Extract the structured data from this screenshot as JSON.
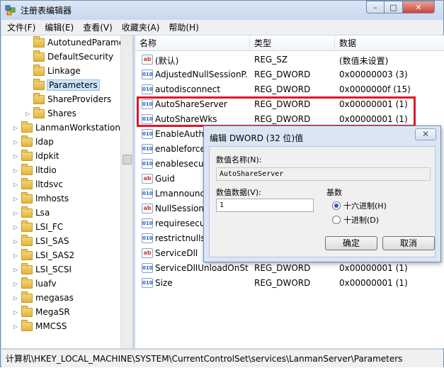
{
  "window": {
    "title": "注册表编辑器",
    "min_label": "–",
    "max_label": "□",
    "close_label": "✕"
  },
  "menu": [
    "文件(F)",
    "编辑(E)",
    "查看(V)",
    "收藏夹(A)",
    "帮助(H)"
  ],
  "tree": {
    "items": [
      {
        "label": "AutotunedParame",
        "expand": ""
      },
      {
        "label": "DefaultSecurity",
        "expand": ""
      },
      {
        "label": "Linkage",
        "expand": ""
      },
      {
        "label": "Parameters",
        "expand": "",
        "selected": true
      },
      {
        "label": "ShareProviders",
        "expand": ""
      },
      {
        "label": "Shares",
        "expand": "▷"
      },
      {
        "label": "LanmanWorkstation",
        "expand": "▷"
      },
      {
        "label": "ldap",
        "expand": "▷"
      },
      {
        "label": "ldpkit",
        "expand": "▷"
      },
      {
        "label": "lltdio",
        "expand": "▷"
      },
      {
        "label": "lltdsvc",
        "expand": "▷"
      },
      {
        "label": "lmhosts",
        "expand": "▷"
      },
      {
        "label": "Lsa",
        "expand": "▷"
      },
      {
        "label": "LSI_FC",
        "expand": "▷"
      },
      {
        "label": "LSI_SAS",
        "expand": "▷"
      },
      {
        "label": "LSI_SAS2",
        "expand": "▷"
      },
      {
        "label": "LSI_SCSI",
        "expand": "▷"
      },
      {
        "label": "luafv",
        "expand": "▷"
      },
      {
        "label": "megasas",
        "expand": "▷"
      },
      {
        "label": "MegaSR",
        "expand": "▷"
      },
      {
        "label": "MMCSS",
        "expand": "▷"
      }
    ]
  },
  "list": {
    "headers": {
      "name": "名称",
      "type": "类型",
      "data": "数据"
    },
    "rows": [
      {
        "icon": "ab",
        "name": "(默认)",
        "type": "REG_SZ",
        "data": "(数值未设置)"
      },
      {
        "icon": "dw",
        "name": "AdjustedNullSessionP...",
        "type": "REG_DWORD",
        "data": "0x00000003 (3)"
      },
      {
        "icon": "dw",
        "name": "autodisconnect",
        "type": "REG_DWORD",
        "data": "0x0000000f (15)"
      },
      {
        "icon": "dw",
        "name": "AutoShareServer",
        "type": "REG_DWORD",
        "data": "0x00000001 (1)"
      },
      {
        "icon": "dw",
        "name": "AutoShareWks",
        "type": "REG_DWORD",
        "data": "0x00000001 (1)"
      },
      {
        "icon": "dw",
        "name": "EnableAuthe",
        "type": "",
        "data": ""
      },
      {
        "icon": "dw",
        "name": "enableforce",
        "type": "",
        "data": ""
      },
      {
        "icon": "dw",
        "name": "enablesecur",
        "type": "",
        "data": ""
      },
      {
        "icon": "ab",
        "name": "Guid",
        "type": "",
        "data": ""
      },
      {
        "icon": "dw",
        "name": "Lmannounce",
        "type": "",
        "data": ""
      },
      {
        "icon": "ab",
        "name": "NullSessionP",
        "type": "",
        "data": ""
      },
      {
        "icon": "dw",
        "name": "requiresecur",
        "type": "",
        "data": ""
      },
      {
        "icon": "dw",
        "name": "restrictnullse",
        "type": "",
        "data": ""
      },
      {
        "icon": "ab",
        "name": "ServiceDll",
        "type": "",
        "data": ""
      },
      {
        "icon": "dw",
        "name": "ServiceDllUnloadOnSt...",
        "type": "REG_DWORD",
        "data": "0x00000001 (1)"
      },
      {
        "icon": "dw",
        "name": "Size",
        "type": "REG_DWORD",
        "data": "0x00000001 (1)"
      }
    ]
  },
  "dialog": {
    "title": "编辑 DWORD (32 位)值",
    "close_label": "✕",
    "name_label": "数值名称(N):",
    "name_value": "AutoShareServer",
    "data_label": "数值数据(V):",
    "data_value": "1",
    "base_label": "基数",
    "hex_label": "十六进制(H)",
    "dec_label": "十进制(D)",
    "ok_label": "确定",
    "cancel_label": "取消"
  },
  "statusbar": {
    "path": "计算机\\HKEY_LOCAL_MACHINE\\SYSTEM\\CurrentControlSet\\services\\LanmanServer\\Parameters"
  },
  "colors": {
    "highlight": "#e3152a",
    "selection": "#cde4fb"
  }
}
